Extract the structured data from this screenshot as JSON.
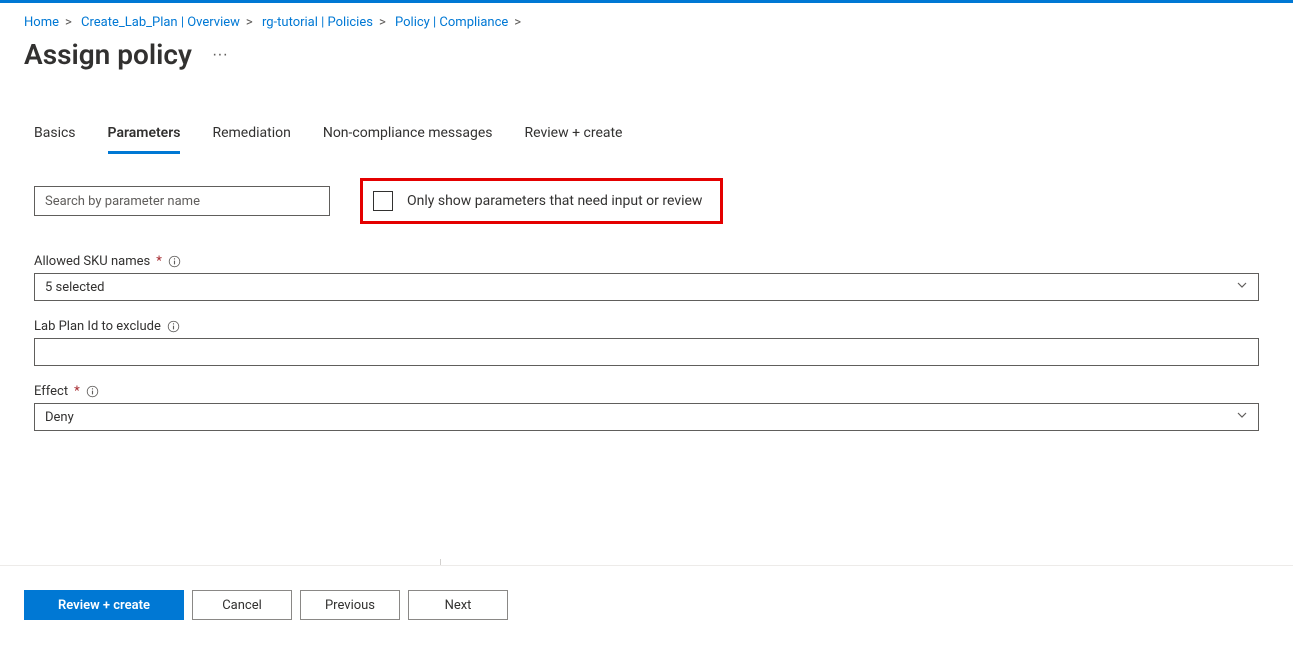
{
  "breadcrumb": [
    {
      "label": "Home"
    },
    {
      "label": "Create_Lab_Plan | Overview"
    },
    {
      "label": "rg-tutorial | Policies"
    },
    {
      "label": "Policy | Compliance"
    }
  ],
  "page_title": "Assign policy",
  "tabs": [
    {
      "label": "Basics",
      "active": false
    },
    {
      "label": "Parameters",
      "active": true
    },
    {
      "label": "Remediation",
      "active": false
    },
    {
      "label": "Non-compliance messages",
      "active": false
    },
    {
      "label": "Review + create",
      "active": false
    }
  ],
  "search_placeholder": "Search by parameter name",
  "only_show_label": "Only show parameters that need input or review",
  "only_show_checked": false,
  "fields": {
    "allowed_skus": {
      "label": "Allowed SKU names",
      "required": true,
      "info": true,
      "value": "5 selected"
    },
    "lab_plan_exclude": {
      "label": "Lab Plan Id to exclude",
      "required": false,
      "info": true,
      "value": ""
    },
    "effect": {
      "label": "Effect",
      "required": true,
      "info": true,
      "value": "Deny"
    }
  },
  "footer": {
    "review_create": "Review + create",
    "cancel": "Cancel",
    "previous": "Previous",
    "next": "Next"
  }
}
